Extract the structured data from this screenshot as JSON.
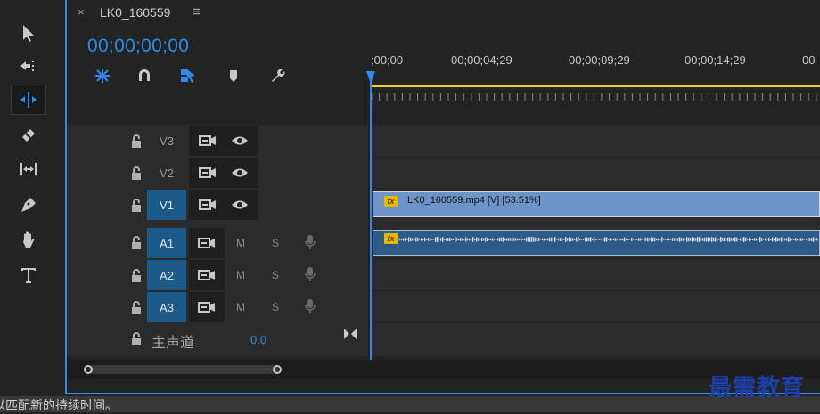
{
  "tab": {
    "close": "×",
    "title": "LK0_160559",
    "menu": "≡"
  },
  "timecode": "00;00;00;00",
  "ruler": {
    "labels": [
      ";00;00",
      "00;00;04;29",
      "00;00;09;29",
      "00;00;14;29",
      "00"
    ]
  },
  "tracks": {
    "v3": "V3",
    "v2": "V2",
    "v1": "V1",
    "a1": "A1",
    "a2": "A2",
    "a3": "A3",
    "m": "M",
    "s": "S",
    "master_label": "主声道",
    "master_value": "0.0"
  },
  "clips": {
    "video": "LK0_160559.mp4 [V] [53.51%]",
    "fx": "fx"
  },
  "status": {
    "text": "以匹配新的持续时间。"
  },
  "watermark": "最需教育",
  "colors": {
    "accent": "#2d8ceb",
    "work_area": "#e9d51c",
    "video_clip": "#6d94c8",
    "audio_clip": "#305a86",
    "track_target": "#1d5a8c"
  }
}
